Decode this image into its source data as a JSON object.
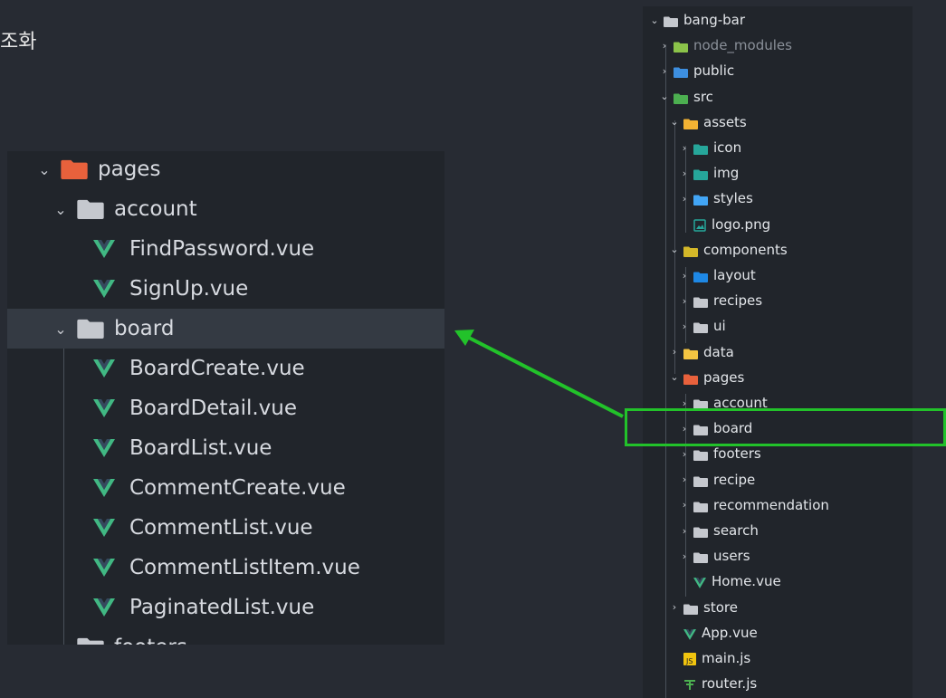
{
  "caption": "조화",
  "zoom": {
    "rows": [
      {
        "label": "pages",
        "kind": "folder-pages",
        "indent": 0,
        "expanded": true
      },
      {
        "label": "account",
        "kind": "folder",
        "indent": 1,
        "expanded": true
      },
      {
        "label": "FindPassword.vue",
        "kind": "vue",
        "indent": 2
      },
      {
        "label": "SignUp.vue",
        "kind": "vue",
        "indent": 2
      },
      {
        "label": "board",
        "kind": "folder",
        "indent": 1,
        "expanded": true,
        "selected": true
      },
      {
        "label": "BoardCreate.vue",
        "kind": "vue",
        "indent": 2
      },
      {
        "label": "BoardDetail.vue",
        "kind": "vue",
        "indent": 2
      },
      {
        "label": "BoardList.vue",
        "kind": "vue",
        "indent": 2
      },
      {
        "label": "CommentCreate.vue",
        "kind": "vue",
        "indent": 2
      },
      {
        "label": "CommentList.vue",
        "kind": "vue",
        "indent": 2
      },
      {
        "label": "CommentListItem.vue",
        "kind": "vue",
        "indent": 2
      },
      {
        "label": "PaginatedList.vue",
        "kind": "vue",
        "indent": 2
      },
      {
        "label": "footers",
        "kind": "folder",
        "indent": 1,
        "expanded": false
      }
    ]
  },
  "tree": {
    "rows": [
      {
        "label": "bang-bar",
        "kind": "folder",
        "indent": 0,
        "expanded": true
      },
      {
        "label": "node_modules",
        "kind": "folder-node",
        "indent": 1,
        "expanded": false,
        "dim": true
      },
      {
        "label": "public",
        "kind": "folder-public",
        "indent": 1,
        "expanded": false
      },
      {
        "label": "src",
        "kind": "folder-src",
        "indent": 1,
        "expanded": true
      },
      {
        "label": "assets",
        "kind": "folder-assets",
        "indent": 2,
        "expanded": true
      },
      {
        "label": "icon",
        "kind": "folder-img",
        "indent": 3,
        "expanded": false
      },
      {
        "label": "img",
        "kind": "folder-img",
        "indent": 3,
        "expanded": false
      },
      {
        "label": "styles",
        "kind": "folder-styles",
        "indent": 3,
        "expanded": false
      },
      {
        "label": "logo.png",
        "kind": "file-image",
        "indent": 3
      },
      {
        "label": "components",
        "kind": "folder-components",
        "indent": 2,
        "expanded": true
      },
      {
        "label": "layout",
        "kind": "folder-layout",
        "indent": 3,
        "expanded": false
      },
      {
        "label": "recipes",
        "kind": "folder",
        "indent": 3,
        "expanded": false
      },
      {
        "label": "ui",
        "kind": "folder",
        "indent": 3,
        "expanded": false
      },
      {
        "label": "data",
        "kind": "folder-data",
        "indent": 2,
        "expanded": false
      },
      {
        "label": "pages",
        "kind": "folder-pages",
        "indent": 2,
        "expanded": true
      },
      {
        "label": "account",
        "kind": "folder",
        "indent": 3,
        "expanded": false
      },
      {
        "label": "board",
        "kind": "folder",
        "indent": 3,
        "expanded": false
      },
      {
        "label": "footers",
        "kind": "folder",
        "indent": 3,
        "expanded": false
      },
      {
        "label": "recipe",
        "kind": "folder",
        "indent": 3,
        "expanded": false
      },
      {
        "label": "recommendation",
        "kind": "folder",
        "indent": 3,
        "expanded": false
      },
      {
        "label": "search",
        "kind": "folder",
        "indent": 3,
        "expanded": false
      },
      {
        "label": "users",
        "kind": "folder",
        "indent": 3,
        "expanded": false
      },
      {
        "label": "Home.vue",
        "kind": "vue",
        "indent": 3
      },
      {
        "label": "store",
        "kind": "folder",
        "indent": 2,
        "expanded": false
      },
      {
        "label": "App.vue",
        "kind": "vue",
        "indent": 2
      },
      {
        "label": "main.js",
        "kind": "js",
        "indent": 2
      },
      {
        "label": "router.js",
        "kind": "router",
        "indent": 2
      }
    ]
  },
  "colors": {
    "highlight": "#22c22a",
    "vue": "#41b883",
    "folder": "#c5c8ce",
    "pages_folder": "#e8613c"
  }
}
